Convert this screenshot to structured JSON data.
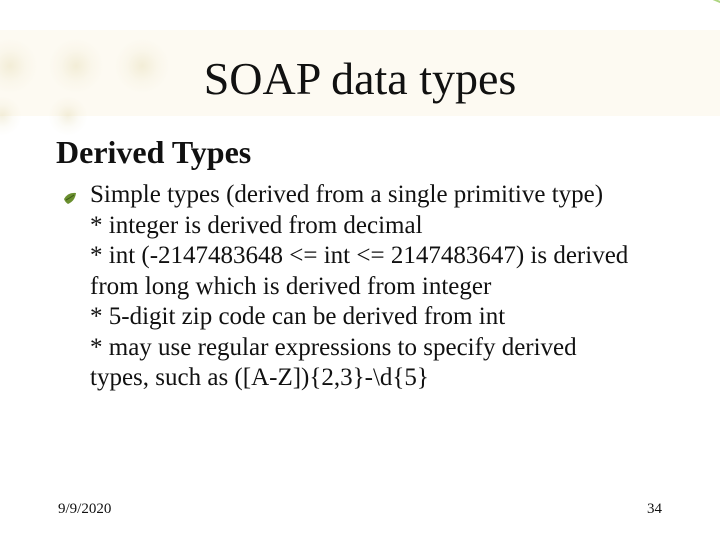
{
  "title": "SOAP data types",
  "subtitle": "Derived Types",
  "body": {
    "line1": "Simple types (derived from a single primitive type)",
    "line2": "* integer is derived from decimal",
    "line3": "* int (-2147483648 <= int <= 2147483647) is derived",
    "line4": "from long which is derived from integer",
    "line5": "* 5-digit zip code can be derived from int",
    "line6": "* may use regular expressions to specify derived",
    "line7": "types, such as ([A-Z]){2,3}-\\d{5}"
  },
  "footer": {
    "date": "9/9/2020",
    "page": "34"
  },
  "icons": {
    "bullet": "leaf-icon"
  }
}
